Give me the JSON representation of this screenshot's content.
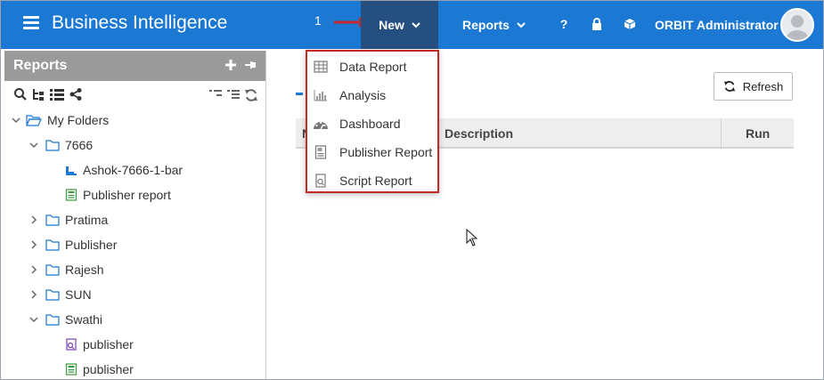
{
  "header": {
    "title": "Business Intelligence",
    "step_number": "1",
    "new_label": "New",
    "reports_label": "Reports",
    "help_glyph": "?",
    "user_name": "ORBIT Administrator"
  },
  "sidebar": {
    "title": "Reports",
    "tree": [
      {
        "label": "My Folders",
        "icon": "folder-open-icon"
      },
      {
        "label": "7666",
        "icon": "folder-icon"
      },
      {
        "label": "Ashok-7666-1-bar",
        "icon": "bar-report-icon"
      },
      {
        "label": "Publisher report",
        "icon": "publisher-report-icon"
      },
      {
        "label": "Pratima",
        "icon": "folder-icon"
      },
      {
        "label": "Publisher",
        "icon": "folder-icon"
      },
      {
        "label": "Rajesh",
        "icon": "folder-icon"
      },
      {
        "label": "SUN",
        "icon": "folder-icon"
      },
      {
        "label": "Swathi",
        "icon": "folder-icon"
      },
      {
        "label": "publisher",
        "icon": "script-report-icon"
      },
      {
        "label": "publisher",
        "icon": "publisher-report-icon"
      }
    ]
  },
  "main": {
    "refresh_label": "Refresh",
    "columns": {
      "name_initial": "N",
      "description": "Description",
      "run": "Run"
    }
  },
  "new_menu": {
    "items": [
      {
        "label": "Data Report",
        "icon": "table-icon"
      },
      {
        "label": "Analysis",
        "icon": "bar-chart-icon"
      },
      {
        "label": "Dashboard",
        "icon": "gauge-icon"
      },
      {
        "label": "Publisher Report",
        "icon": "publisher-report-icon"
      },
      {
        "label": "Script Report",
        "icon": "script-report-icon"
      }
    ]
  },
  "colors": {
    "topbar": "#1b79d3",
    "new_active": "#244f80",
    "highlight_border": "#c62828",
    "annotation_arrow": "#c62828",
    "sidebar_header": "#9a9a9a"
  }
}
